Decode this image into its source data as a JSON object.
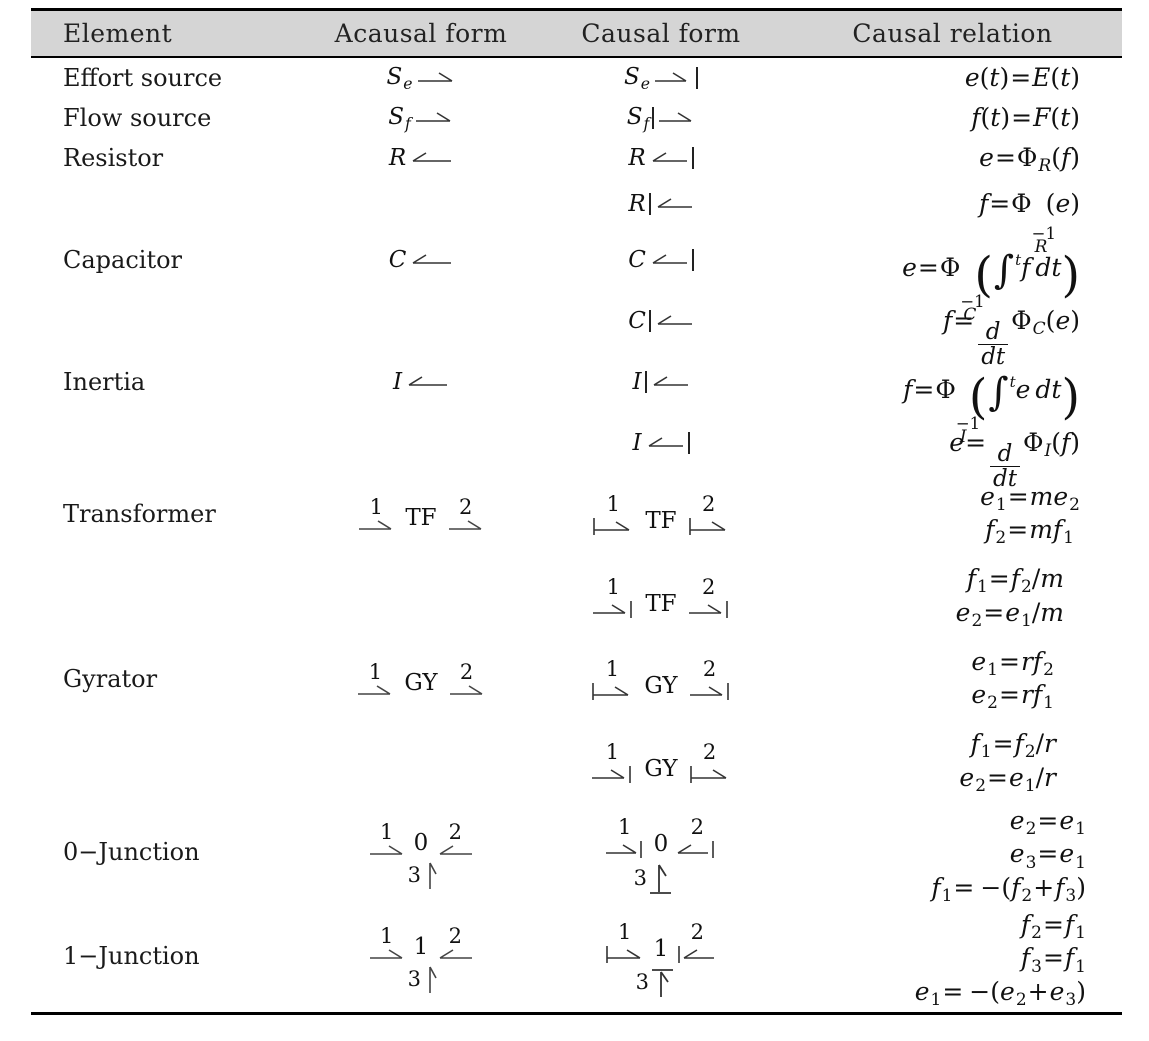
{
  "table": {
    "caption_headers": [
      "Element",
      "Acausal form",
      "Causal form",
      "Causal relation"
    ],
    "header_bg": "#d5d5d5",
    "rule_color": "#000000",
    "rows": [
      {
        "element": "Effort source",
        "acausal": {
          "label": "S",
          "sub": "e",
          "arrow": "right-harpoon",
          "bar": "none"
        },
        "lines": [
          {
            "causal": {
              "label": "S",
              "sub": "e",
              "arrow": "right-harpoon",
              "bar": "after"
            },
            "relation": [
              "e( t ) = E( t )"
            ]
          }
        ]
      },
      {
        "element": "Flow source",
        "acausal": {
          "label": "S",
          "sub": "f",
          "arrow": "right-harpoon",
          "bar": "none"
        },
        "lines": [
          {
            "causal": {
              "label": "S",
              "sub": "f",
              "arrow": "right-harpoon",
              "bar": "before"
            },
            "relation": [
              "f( t ) = F( t )"
            ]
          }
        ]
      },
      {
        "element": "Resistor",
        "acausal": {
          "label": "R",
          "sub": "",
          "arrow": "left-harpoon",
          "bar": "none"
        },
        "lines": [
          {
            "causal": {
              "label": "R",
              "sub": "",
              "arrow": "left-harpoon",
              "bar": "after"
            },
            "relation": [
              "e = Φ R( f )"
            ]
          },
          {
            "causal": {
              "label": "R",
              "sub": "",
              "arrow": "left-harpoon",
              "bar": "before"
            },
            "relation": [
              "f = Φ R^-1( e )"
            ]
          }
        ]
      },
      {
        "element": "Capacitor",
        "acausal": {
          "label": "C",
          "sub": "",
          "arrow": "left-harpoon",
          "bar": "none"
        },
        "lines": [
          {
            "causal": {
              "label": "C",
              "sub": "",
              "arrow": "left-harpoon",
              "bar": "after"
            },
            "relation": [
              "e = Φ C^-1 ( ∫ t f dt )"
            ]
          },
          {
            "causal": {
              "label": "C",
              "sub": "",
              "arrow": "left-harpoon",
              "bar": "before"
            },
            "relation": [
              "f = d/dt Φ C( e )"
            ]
          }
        ]
      },
      {
        "element": "Inertia",
        "acausal": {
          "label": "I",
          "sub": "",
          "arrow": "left-harpoon",
          "bar": "none"
        },
        "lines": [
          {
            "causal": {
              "label": "I",
              "sub": "",
              "arrow": "left-harpoon",
              "bar": "before"
            },
            "relation": [
              "f = Φ I^-1 ( ∫ t e dt )"
            ]
          },
          {
            "causal": {
              "label": "I",
              "sub": "",
              "arrow": "left-harpoon",
              "bar": "after"
            },
            "relation": [
              "e = d/dt Φ I( f )"
            ]
          }
        ]
      },
      {
        "element": "Transformer",
        "acausal": {
          "name": "TF",
          "ports": [
            "1",
            "2"
          ],
          "p1": "right-harpoon-nobar",
          "p2": "right-harpoon-nobar"
        },
        "lines": [
          {
            "causal": {
              "name": "TF",
              "ports": [
                "1",
                "2"
              ],
              "p1": "bar-right-harpoon",
              "p2": "bar-right-harpoon"
            },
            "relation": [
              "e 1 = me 2",
              "f 2 = mf 1"
            ]
          },
          {
            "causal": {
              "name": "TF",
              "ports": [
                "1",
                "2"
              ],
              "p1": "right-harpoon-bar",
              "p2": "right-harpoon-bar"
            },
            "relation": [
              "f 1 = f 2 / m",
              "e 2 = e 1 / m"
            ]
          }
        ]
      },
      {
        "element": "Gyrator",
        "acausal": {
          "name": "GY",
          "ports": [
            "1",
            "2"
          ],
          "p1": "right-harpoon-nobar",
          "p2": "right-harpoon-nobar"
        },
        "lines": [
          {
            "causal": {
              "name": "GY",
              "ports": [
                "1",
                "2"
              ],
              "p1": "bar-right-harpoon",
              "p2": "right-harpoon-bar"
            },
            "relation": [
              "e 1 = rf 2",
              "e 2 = rf 1"
            ]
          },
          {
            "causal": {
              "name": "GY",
              "ports": [
                "1",
                "2"
              ],
              "p1": "right-harpoon-bar",
              "p2": "bar-right-harpoon"
            },
            "relation": [
              "f 1 = f 2 / r",
              "e 2 = e 1 / r"
            ]
          }
        ]
      },
      {
        "element": "0−Junction",
        "acausal": {
          "name": "0",
          "ports": [
            "1",
            "2",
            "3"
          ],
          "p1": "right-harpoon-nobar",
          "p2": "left-harpoon-nobar",
          "p3": "up-harpoon-nobar"
        },
        "lines": [
          {
            "causal": {
              "name": "0",
              "ports": [
                "1",
                "2",
                "3"
              ],
              "p1": "right-harpoon-bar",
              "p2": "left-harpoon-bar",
              "p3": "up-harpoon-barbottom"
            },
            "relation": [
              "e 2 = e 1",
              "e 3 = e 1",
              "f 1 = − ( f 2 + f 3 )"
            ]
          }
        ]
      },
      {
        "element": "1−Junction",
        "acausal": {
          "name": "1",
          "ports": [
            "1",
            "2",
            "3"
          ],
          "p1": "right-harpoon-nobar",
          "p2": "left-harpoon-nobar",
          "p3": "up-harpoon-nobar"
        },
        "lines": [
          {
            "causal": {
              "name": "1",
              "ports": [
                "1",
                "2",
                "3"
              ],
              "p1": "bar-right-harpoon",
              "p2": "bar-left-harpoon",
              "p3": "up-harpoon-bartop"
            },
            "relation": [
              "f 2 = f 1",
              "f 3 = f 1",
              "e 1 = − ( e 2 + e 3 )"
            ]
          }
        ]
      }
    ]
  }
}
